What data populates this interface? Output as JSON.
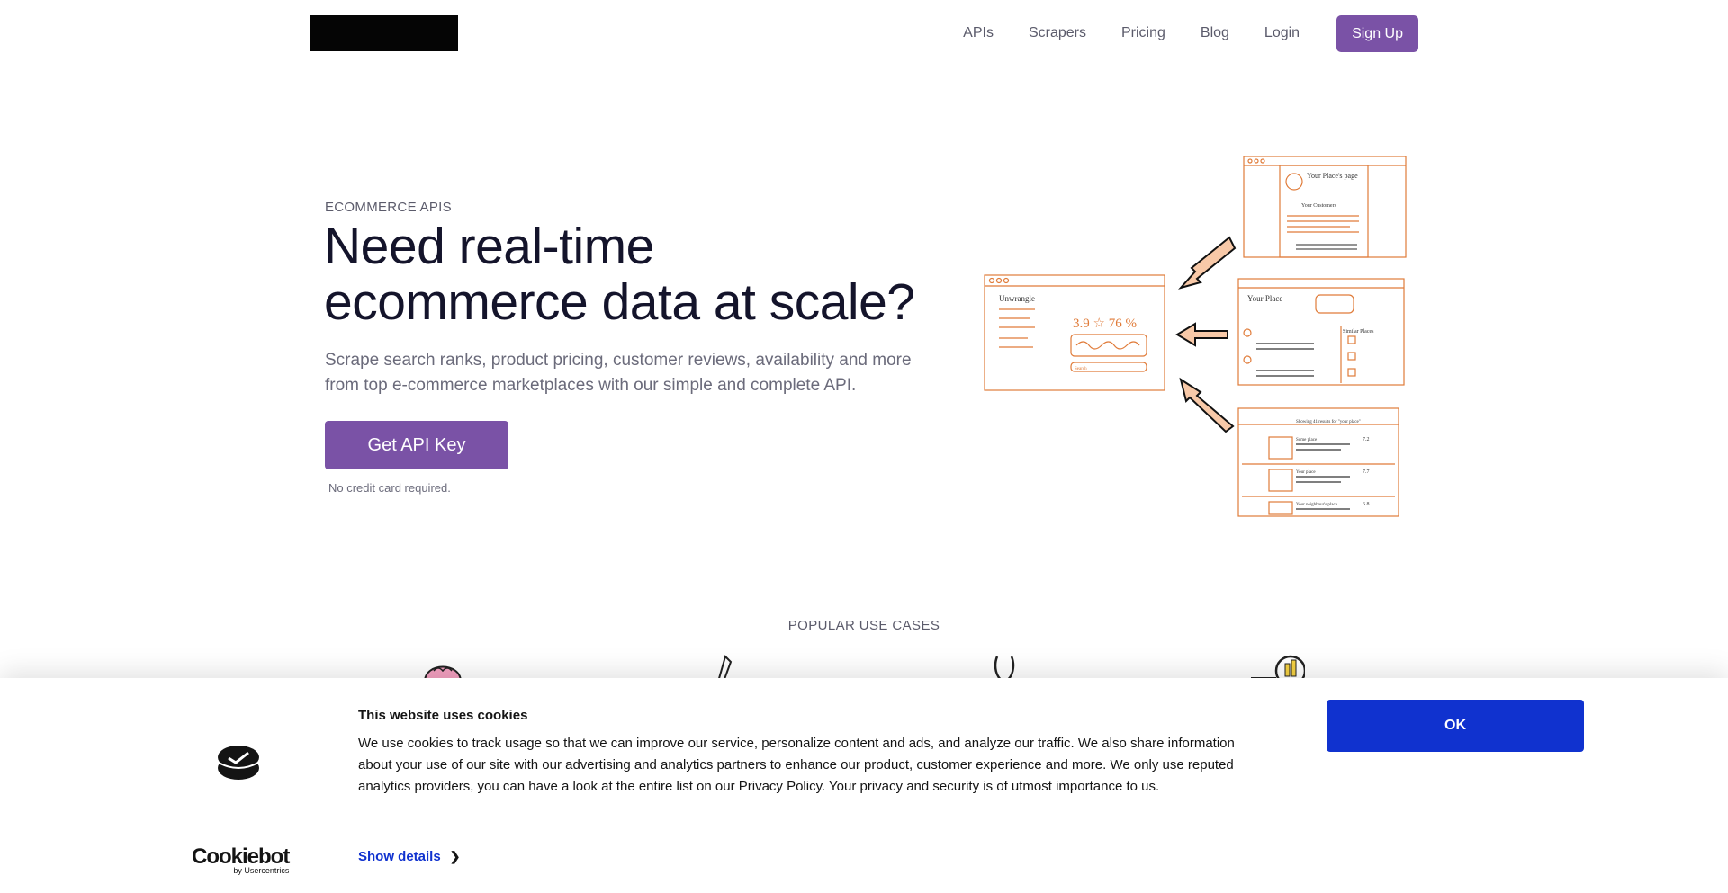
{
  "nav": {
    "items": [
      "APIs",
      "Scrapers",
      "Pricing",
      "Blog",
      "Login"
    ],
    "signup": "Sign Up"
  },
  "hero": {
    "eyebrow": "ECOMMERCE APIS",
    "title_line1": "Need real-time",
    "title_line2": "ecommerce data at scale?",
    "subtitle_line1": "Scrape search ranks, product pricing, customer reviews, availability and more",
    "subtitle_line2": "from top e-commerce marketplaces with our simple and complete API.",
    "cta": "Get API Key",
    "note": "No credit card required."
  },
  "illustration": {
    "main_title": "Unwrangle",
    "stats": "3.9 ☆ 76 %",
    "search": "Search",
    "page_title": "Your Place's page",
    "customers": "Your Customers",
    "place_title": "Your Place",
    "similar": "Similar Places",
    "results": "Showing 41 results for \"your place\"",
    "row1": "Some place",
    "row1_score": "7.2",
    "row2": "Your place",
    "row2_score": "7.7",
    "row3": "Your neighbour's place",
    "row3_score": "6.8"
  },
  "use_cases": {
    "title": "POPULAR USE CASES",
    "icons": [
      "brain-icon",
      "pen-icon",
      "stethoscope-icon",
      "chart-icon"
    ]
  },
  "cookie": {
    "title": "This website uses cookies",
    "text": "We use cookies to track usage so that we can improve our service, personalize content and ads, and analyze our traffic. We also share information about your use of our site with our advertising and analytics partners to enhance our product, customer experience and more. We only use reputed analytics providers, you can have a look at the entire list on our Privacy Policy. Your privacy and security is of utmost importance to us.",
    "details": "Show details",
    "ok": "OK",
    "logo_main": "Cookiebot",
    "logo_sub": "by Usercentrics"
  },
  "colors": {
    "brand_purple": "#7a52a6",
    "cookie_blue": "#1032cf",
    "sketch_orange": "#e07b39",
    "arrow_fill": "#f8c9a8"
  }
}
